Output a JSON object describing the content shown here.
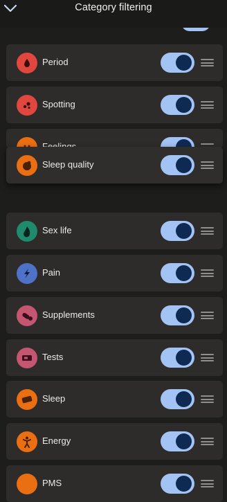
{
  "header": {
    "title": "Category filtering",
    "back_icon": "chevron-down-icon"
  },
  "colors": {
    "toggle_track": "#a3c3f4",
    "toggle_knob": "#0f2a52",
    "card": "#2d2c2a"
  },
  "categories": [
    {
      "label": "Period",
      "icon": "drop-icon",
      "icon_color": "#e1463f",
      "enabled": true
    },
    {
      "label": "Spotting",
      "icon": "dots-icon",
      "icon_color": "#e1463f",
      "enabled": true
    },
    {
      "label": "Feelings",
      "icon": "smiley-icon",
      "icon_color": "#ea6f12",
      "enabled": true
    },
    {
      "label": "Sleep quality",
      "icon": "sleep-face-icon",
      "icon_color": "#ea6f12",
      "enabled": true
    },
    {
      "label": "Sex life",
      "icon": "flame-icon",
      "icon_color": "#1f8a6c",
      "enabled": true
    },
    {
      "label": "Pain",
      "icon": "lightning-icon",
      "icon_color": "#4d72c7",
      "enabled": true
    },
    {
      "label": "Supplements",
      "icon": "pill-icon",
      "icon_color": "#c55672",
      "enabled": true
    },
    {
      "label": "Tests",
      "icon": "test-strip-icon",
      "icon_color": "#c55672",
      "enabled": true
    },
    {
      "label": "Sleep",
      "icon": "mask-icon",
      "icon_color": "#ea6f12",
      "enabled": true
    },
    {
      "label": "Energy",
      "icon": "person-icon",
      "icon_color": "#ea6f12",
      "enabled": true
    },
    {
      "label": "PMS",
      "icon": "pms-icon",
      "icon_color": "#ea6f12",
      "enabled": true
    }
  ]
}
